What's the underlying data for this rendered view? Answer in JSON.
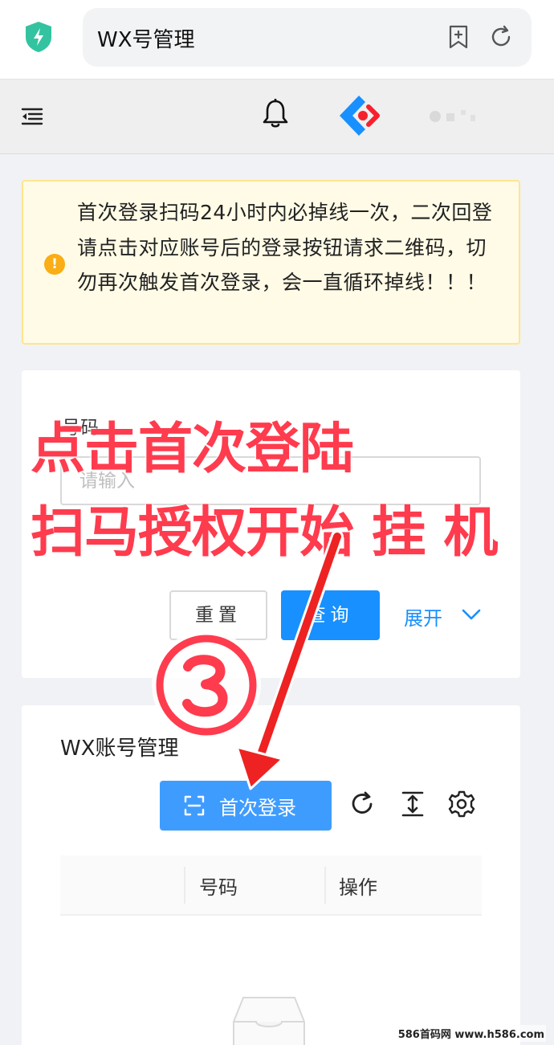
{
  "browser": {
    "url_title": "WX号管理",
    "icons": [
      "shield-icon",
      "bookmark-add-icon",
      "reload-icon"
    ]
  },
  "header": {
    "icons": [
      "menu-collapse-icon",
      "bell-icon",
      "app-logo-icon"
    ]
  },
  "alert": {
    "message": "首次登录扫码24小时内必掉线一次，二次回登请点击对应账号后的登录按钮请求二维码，切勿再次触发首次登录，会一直循环掉线！！！",
    "icon_glyph": "!",
    "color": "#faad14"
  },
  "search": {
    "field_label": "号码",
    "input_placeholder": "请输入",
    "input_value": "",
    "reset_label": "重置",
    "query_label": "查询",
    "expand_label": "展开"
  },
  "table_card": {
    "title": "WX账号管理",
    "first_login_label": "首次登录",
    "toolbar_icons": [
      "reload-icon",
      "column-height-icon",
      "settings-icon"
    ],
    "columns": [
      "",
      "号码",
      "操作"
    ],
    "rows": []
  },
  "annotation": {
    "line1": "点击首次登陆",
    "line2": "扫马授权开始 挂 机",
    "step": "③",
    "color": "#ff3b4e"
  },
  "watermark": "586首码网 www.h586.com",
  "colors": {
    "primary": "#1890ff",
    "alert_bg": "#fffbe6",
    "alert_border": "#ffe58f"
  }
}
